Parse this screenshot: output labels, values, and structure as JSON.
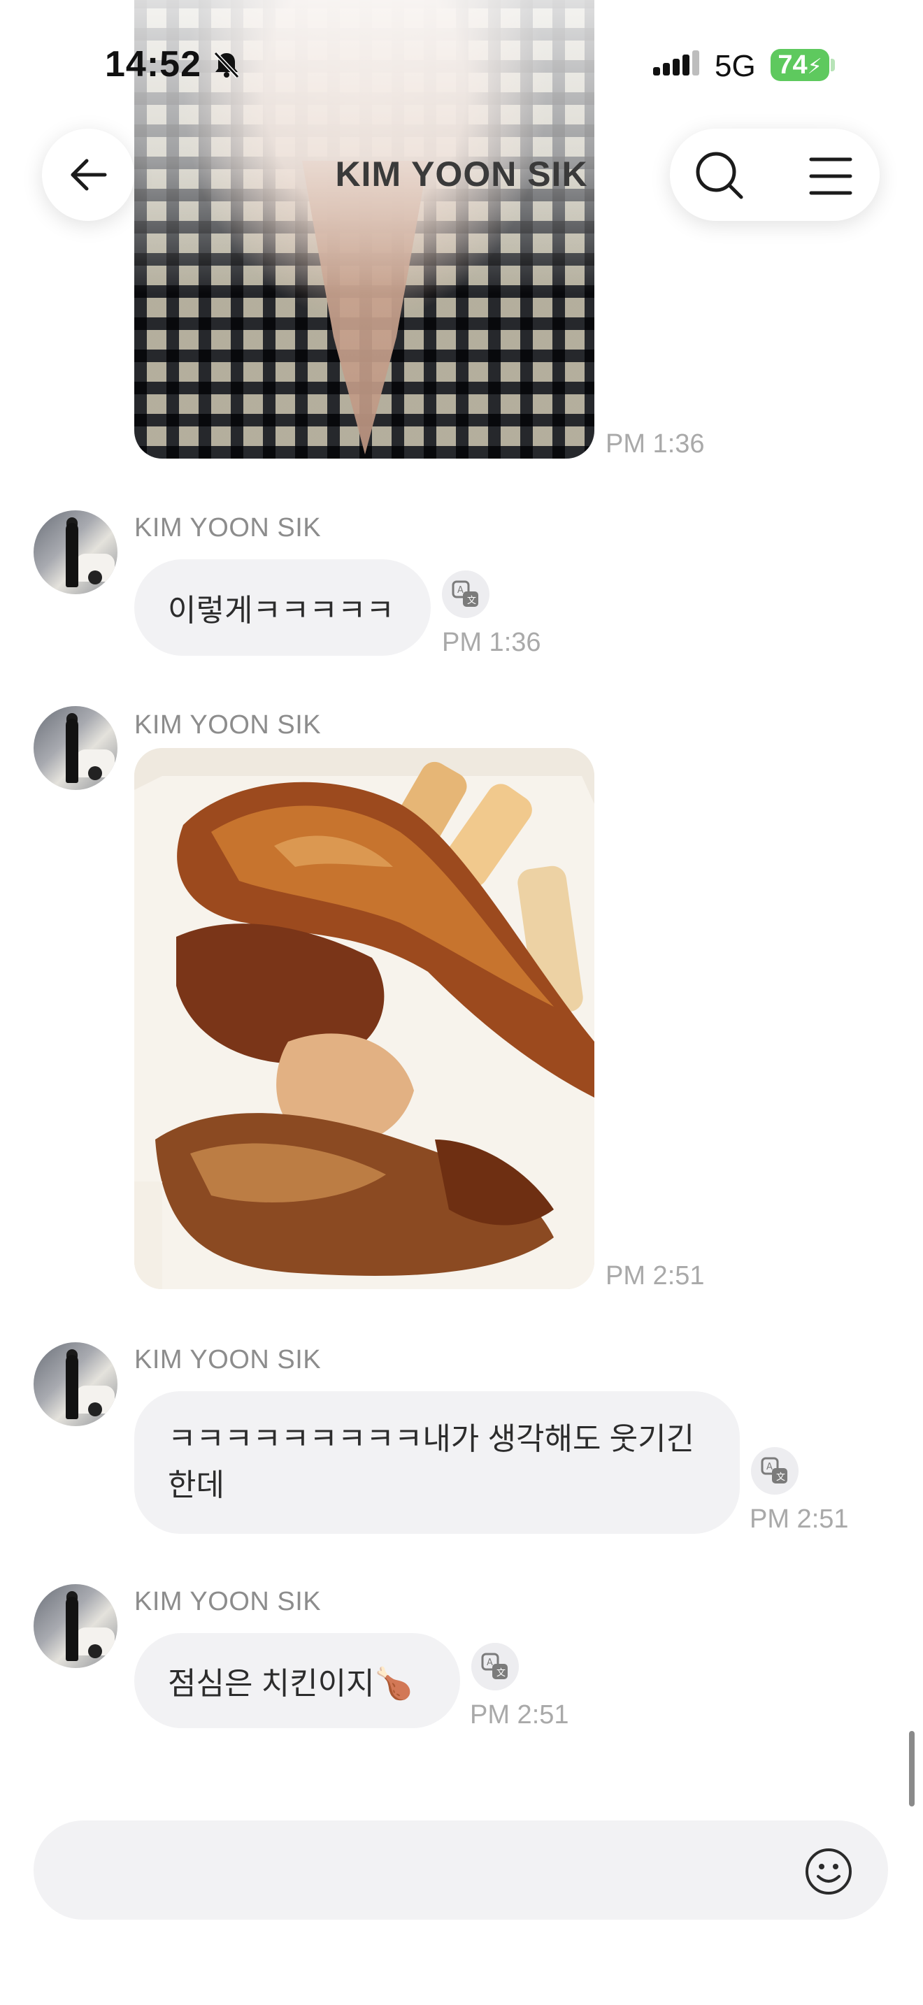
{
  "status_bar": {
    "time": "14:52",
    "network": "5G",
    "battery": "74"
  },
  "header": {
    "title": "KIM YOON SIK"
  },
  "messages": [
    {
      "type": "image",
      "time": "PM 1:36"
    },
    {
      "type": "text",
      "sender": "KIM YOON SIK",
      "text": "이렇게ㅋㅋㅋㅋㅋ",
      "time": "PM 1:36"
    },
    {
      "type": "image",
      "sender": "KIM YOON SIK",
      "time": "PM 2:51"
    },
    {
      "type": "text",
      "sender": "KIM YOON SIK",
      "lines": [
        "ㅋㅋㅋㅋㅋㅋㅋㅋㅋ내가 생각해도 웃기긴",
        "한데"
      ],
      "time": "PM 2:51"
    },
    {
      "type": "text",
      "sender": "KIM YOON SIK",
      "text": "점심은 치킨이지🍗",
      "time": "PM 2:51"
    }
  ],
  "input": {
    "value": ""
  },
  "icons": {
    "back": "back-arrow-icon",
    "search": "search-icon",
    "menu": "menu-icon",
    "translate": "translate-icon",
    "emoji": "emoji-icon",
    "mute": "bell-slash-icon"
  },
  "colors": {
    "battery": "#5ec95e",
    "bubble": "#f2f2f4",
    "time_text": "#a9a9a9"
  }
}
